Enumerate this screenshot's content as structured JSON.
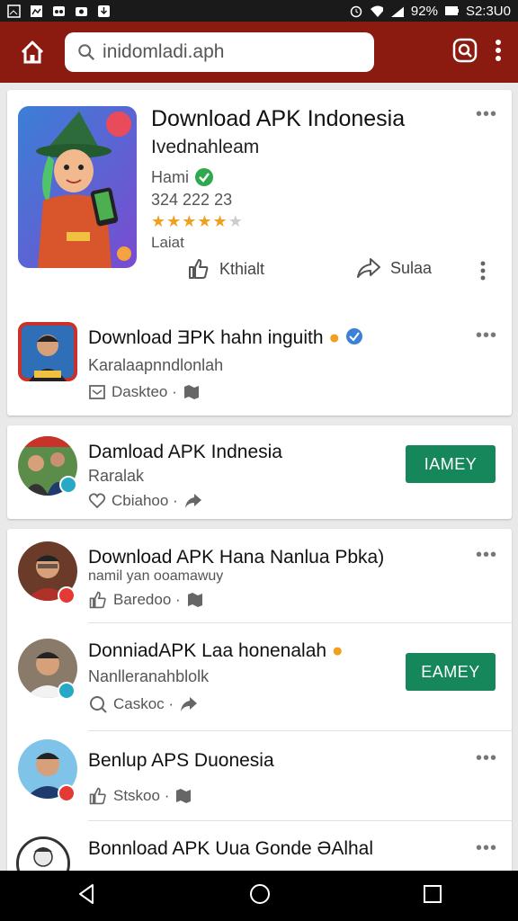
{
  "statusbar": {
    "battery": "92%",
    "time": "S2:3U0",
    "left_icons": [
      "image-icon",
      "gallery-icon",
      "voicemail-icon",
      "camera-icon",
      "download-icon"
    ]
  },
  "search": {
    "value": "inidomladi.aph"
  },
  "featured": {
    "title": "Download APK Indonesia",
    "subtitle": "Ivednahleam",
    "author": "Hami",
    "count": "324 222 23",
    "rating": 4.5,
    "rating_label": "Laiat",
    "like_label": "Kthialt",
    "share_label": "Sulaa"
  },
  "items": [
    {
      "title": "Download ƎPK hahn inguith",
      "subtitle": "Karalaapnndlonlah",
      "meta": "Daskteo ·"
    },
    {
      "title": "Damload APK Indnesia",
      "subtitle": "Raralak",
      "meta": "Cbiahoo ·",
      "button": "IAMEY"
    },
    {
      "title": "Download APK Hana Nanlua Pbka)",
      "subtitle": "namil yan ooamawuy",
      "meta": "Baredoo ·"
    },
    {
      "title": "DonniadAPK Laa honenalah",
      "subtitle": "Nanlleranahblolk",
      "meta": "Caskoc ·",
      "button": "EAMEY"
    },
    {
      "title": "Benlup APS Duonesia",
      "subtitle": "",
      "meta": "Stskoo ·"
    },
    {
      "title": "Bonnload APK Uua Gonde ƏAlhal",
      "subtitle": "",
      "meta": ""
    }
  ],
  "colors": {
    "appbar": "#8b1a10",
    "accent_button": "#15875a",
    "verified": "#2fa84f",
    "star": "#f0a020",
    "badge_red": "#e53935",
    "badge_teal": "#27a9c6"
  }
}
